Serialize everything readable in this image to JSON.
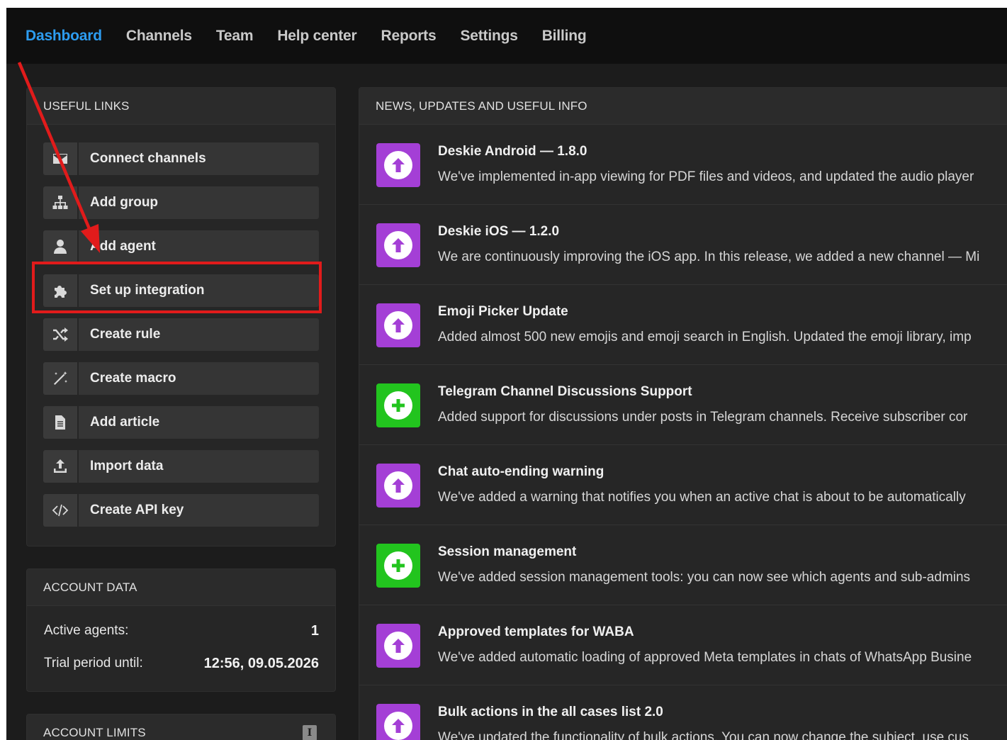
{
  "nav": {
    "items": [
      "Dashboard",
      "Channels",
      "Team",
      "Help center",
      "Reports",
      "Settings",
      "Billing"
    ],
    "active": "Dashboard",
    "active_color": "#2d9cf0"
  },
  "useful_links": {
    "title": "USEFUL LINKS",
    "items": [
      {
        "label": "Connect channels",
        "icon": "envelope-icon"
      },
      {
        "label": "Add group",
        "icon": "sitemap-icon"
      },
      {
        "label": "Add agent",
        "icon": "user-icon"
      },
      {
        "label": "Set up integration",
        "icon": "puzzle-icon"
      },
      {
        "label": "Create rule",
        "icon": "shuffle-icon"
      },
      {
        "label": "Create macro",
        "icon": "magic-wand-icon"
      },
      {
        "label": "Add article",
        "icon": "document-icon"
      },
      {
        "label": "Import data",
        "icon": "upload-icon"
      },
      {
        "label": "Create API key",
        "icon": "code-icon"
      }
    ]
  },
  "account_data": {
    "title": "ACCOUNT DATA",
    "rows": [
      {
        "label": "Active agents:",
        "value": "1"
      },
      {
        "label": "Trial period until:",
        "value": "12:56, 09.05.2026"
      }
    ]
  },
  "account_limits": {
    "title": "ACCOUNT LIMITS",
    "info_icon": "info-icon"
  },
  "news": {
    "title": "NEWS, UPDATES AND USEFUL INFO",
    "colors": {
      "update": "#a43fd6",
      "new": "#22c41e"
    },
    "items": [
      {
        "kind": "update",
        "title": "Deskie Android — 1.8.0",
        "desc": "We've implemented in-app viewing for PDF files and videos, and updated the audio player"
      },
      {
        "kind": "update",
        "title": "Deskie iOS — 1.2.0",
        "desc": "We are continuously improving the iOS app. In this release, we added a new channel — Mi"
      },
      {
        "kind": "update",
        "title": "Emoji Picker Update",
        "desc": "Added almost 500 new emojis and emoji search in English. Updated the emoji library, imp"
      },
      {
        "kind": "new",
        "title": "Telegram Channel Discussions Support",
        "desc": "Added support for discussions under posts in Telegram channels. Receive subscriber cor"
      },
      {
        "kind": "update",
        "title": "Chat auto-ending warning",
        "desc": "We've added a warning that notifies you when an active chat is about to be automatically"
      },
      {
        "kind": "new",
        "title": "Session management",
        "desc": "We've added session management tools: you can now see which agents and sub-admins"
      },
      {
        "kind": "update",
        "title": "Approved templates for WABA",
        "desc": "We've added automatic loading of approved Meta templates in chats of WhatsApp Busine"
      },
      {
        "kind": "update",
        "title": "Bulk actions in the all cases list 2.0",
        "desc": "We've updated the functionality of bulk actions. You can now change the subject, use cus"
      }
    ]
  },
  "annotation": {
    "highlight_color": "#e11b1b"
  }
}
